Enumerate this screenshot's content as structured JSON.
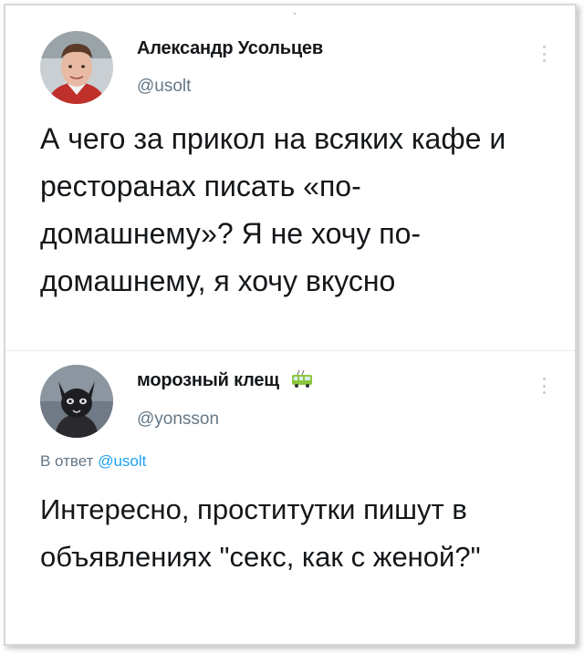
{
  "tweets": [
    {
      "author_name": "Александр Усольцев",
      "handle": "@usolt",
      "text": "А чего за прикол на всяких кафе и ресторанах писать «по-домашнему»? Я не хочу по-домашнему, я хочу вкусно",
      "avatar_icon": "profile-photo-man"
    },
    {
      "author_name": "морозный клещ",
      "author_emoji_icon": "trolleybus-icon",
      "handle": "@yonsson",
      "reply_prefix": "В ответ",
      "reply_mention": "@usolt",
      "text": "Интересно, проститутки пишут в объявлениях \"секс, как с женой?\"",
      "avatar_icon": "profile-photo-dark-cat"
    }
  ],
  "colors": {
    "text": "#14171a",
    "secondary": "#657786",
    "link": "#1da1f2",
    "divider": "#e6ecf0"
  }
}
